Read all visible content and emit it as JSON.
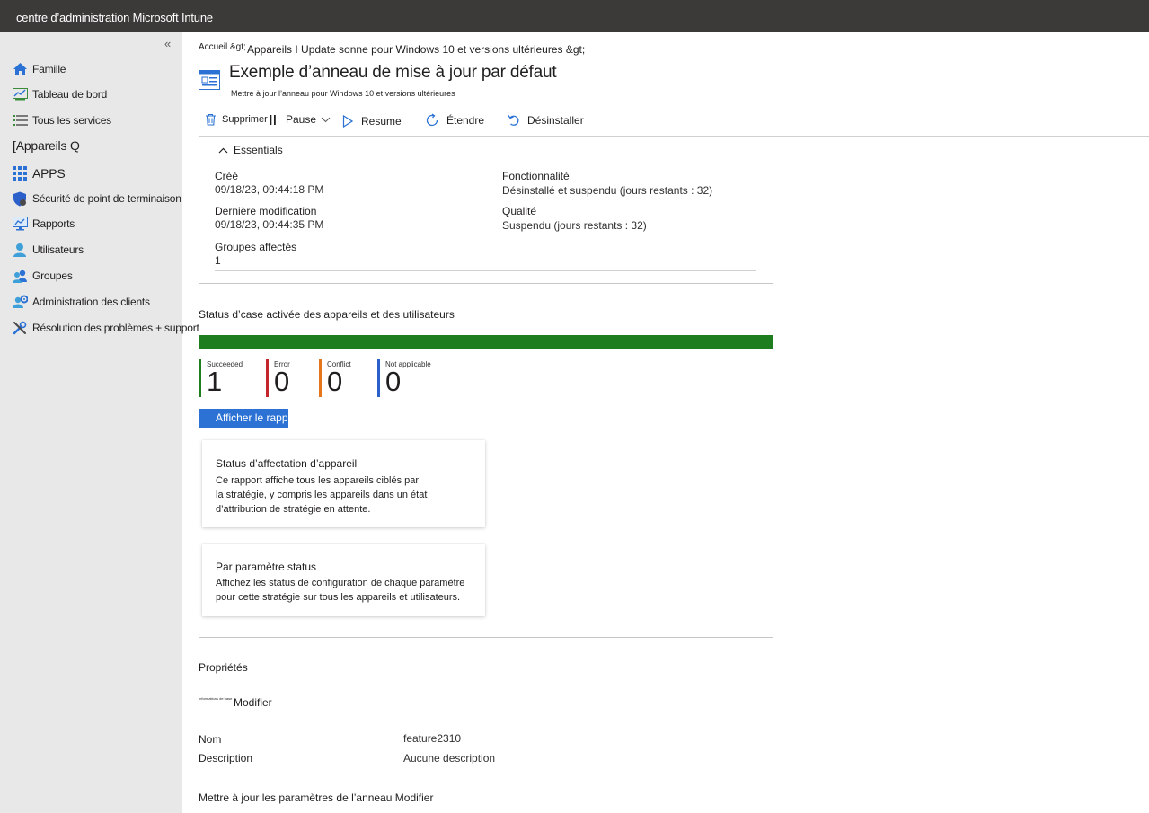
{
  "topbar": {
    "title": "centre d’administration Microsoft Intune"
  },
  "sidebar": {
    "collapse_glyph": "«",
    "items": [
      {
        "label": "Famille",
        "icon": "home-icon"
      },
      {
        "label": "Tableau de bord",
        "icon": "dashboard-icon"
      },
      {
        "label": "Tous les services",
        "icon": "list-icon"
      },
      {
        "label": "[Appareils Q",
        "icon": ""
      },
      {
        "label": "APPS",
        "icon": "apps-grid-icon"
      },
      {
        "label": "Sécurité de point de terminaison",
        "icon": "shield-icon"
      },
      {
        "label": "Rapports",
        "icon": "monitor-chart-icon"
      },
      {
        "label": "Utilisateurs",
        "icon": "user-icon"
      },
      {
        "label": "Groupes",
        "icon": "group-icon"
      },
      {
        "label": "Administration des clients",
        "icon": "tenant-admin-icon"
      },
      {
        "label": "Résolution des problèmes + support",
        "icon": "wrench-icon"
      }
    ]
  },
  "breadcrumb": {
    "home": "Accueil &gt;",
    "path": "Appareils I Update sonne pour Windows 10 et versions ultérieures &gt;"
  },
  "page": {
    "title": "Exemple d’anneau de mise à jour par défaut",
    "subtitle": "Mettre à jour l’anneau pour Windows 10 et versions ultérieures"
  },
  "toolbar": {
    "delete": "Supprimer",
    "pause": "Pause",
    "resume": "Resume",
    "extend": "Étendre",
    "uninstall": "Désinstaller"
  },
  "essentials": {
    "toggle_label": "Essentials",
    "created_label": "Créé",
    "created_value": "09/18/23, 09:44:18 PM",
    "modified_label": "Dernière modification",
    "modified_value": "09/18/23, 09:44:35 PM",
    "groups_label": "Groupes affectés",
    "groups_value": "1",
    "feature_label": "Fonctionnalité",
    "feature_value": "Désinstallé et suspendu (jours restants : 32)",
    "quality_label": "Qualité",
    "quality_value": "Suspendu (jours restants : 32)"
  },
  "status": {
    "title": "Status d’case activée des appareils et des utilisateurs",
    "items": [
      {
        "label": "Succeeded",
        "value": "1",
        "color": "#1e7d1e"
      },
      {
        "label": "Error",
        "value": "0",
        "color": "#c4262e"
      },
      {
        "label": "Conflict",
        "value": "0",
        "color": "#e6761c"
      },
      {
        "label": "Not applicable",
        "value": "0",
        "color": "#2b5fc9"
      }
    ],
    "bar_color": "#1e7d1e",
    "report_button": "Afficher le rapport"
  },
  "cards": [
    {
      "title": "Status d’affectation d’appareil",
      "lines": [
        "Ce rapport affiche tous les appareils ciblés par",
        "la stratégie, y compris les appareils dans un état",
        "d’attribution de stratégie en attente."
      ]
    },
    {
      "title": "Par paramètre status",
      "lines": [
        "Affichez les status de configuration de chaque paramètre",
        "pour cette stratégie sur tous les appareils et utilisateurs."
      ]
    }
  ],
  "properties": {
    "title": "Propriétés",
    "tiny_label": "Informations de base",
    "edit": "Modifier",
    "name_label": "Nom",
    "name_value": "feature2310",
    "description_label": "Description",
    "description_value": "Aucune description",
    "ring_settings": "Mettre à jour les paramètres de l’anneau Modifier"
  },
  "colors": {
    "accent": "#2b72d4",
    "topbar": "#3b3a39",
    "sidebar": "#e8e8e8"
  }
}
